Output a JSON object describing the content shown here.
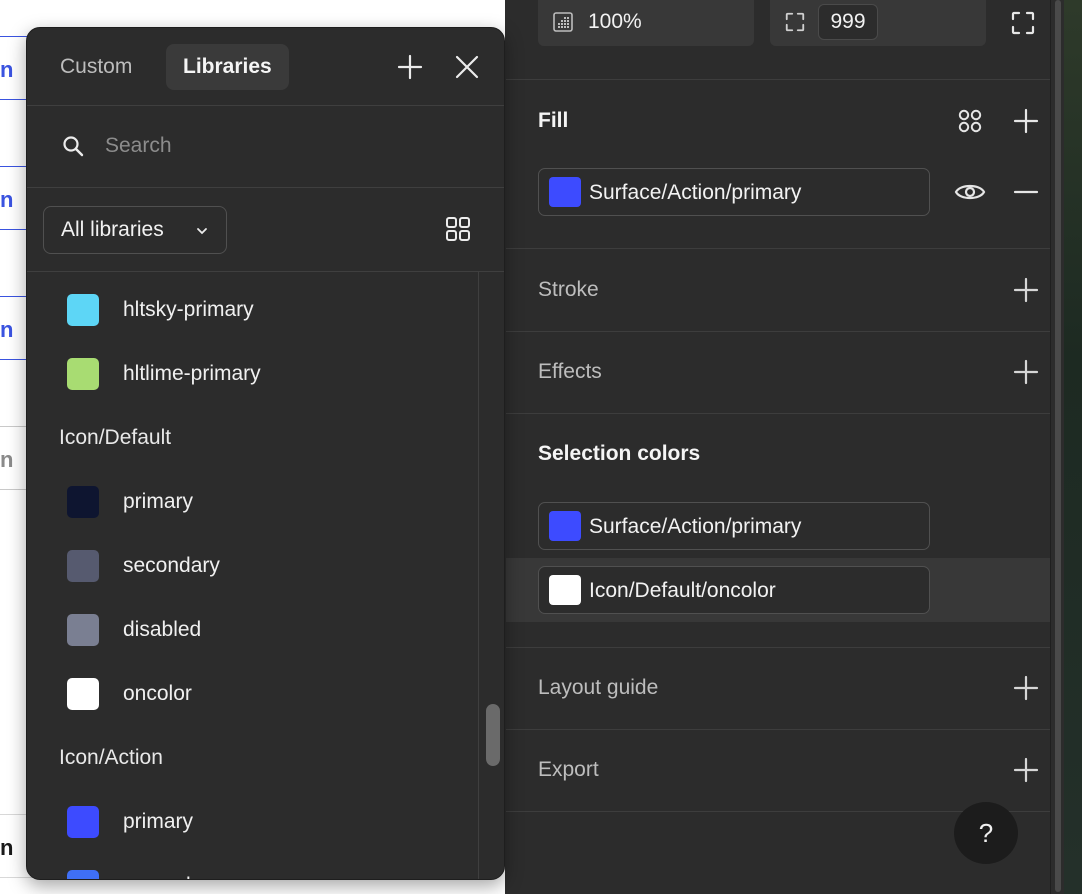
{
  "canvas": {
    "items": [
      {
        "glyph": "n",
        "tone": "blue"
      },
      {
        "glyph": "n",
        "tone": "blue"
      },
      {
        "glyph": "n",
        "tone": "blue"
      },
      {
        "glyph": "n",
        "tone": "grey"
      },
      {
        "glyph": "n",
        "tone": "dark"
      }
    ]
  },
  "properties": {
    "opacity": "100%",
    "corner_radius": "999",
    "fill": {
      "title": "Fill",
      "color": {
        "name": "Surface/Action/primary",
        "hex": "#3d4bff"
      }
    },
    "stroke": {
      "title": "Stroke"
    },
    "effects": {
      "title": "Effects"
    },
    "selection_colors": {
      "title": "Selection colors",
      "items": [
        {
          "name": "Surface/Action/primary",
          "hex": "#3d4bff"
        },
        {
          "name": "Icon/Default/oncolor",
          "hex": "#ffffff"
        }
      ]
    },
    "layout_guide": {
      "title": "Layout guide"
    },
    "export": {
      "title": "Export"
    },
    "help_label": "?"
  },
  "libraries_popover": {
    "tabs": [
      {
        "label": "Custom",
        "active": false
      },
      {
        "label": "Libraries",
        "active": true
      }
    ],
    "search": {
      "placeholder": "Search",
      "value": ""
    },
    "library_filter": "All libraries",
    "list": {
      "ungrouped": [
        {
          "name": "hltsky-primary",
          "hex": "#5dd6f6"
        },
        {
          "name": "hltlime-primary",
          "hex": "#a8dc72"
        }
      ],
      "groups": [
        {
          "title": "Icon/Default",
          "items": [
            {
              "name": "primary",
              "hex": "#0e1530"
            },
            {
              "name": "secondary",
              "hex": "#565a6f"
            },
            {
              "name": "disabled",
              "hex": "#7a7f92"
            },
            {
              "name": "oncolor",
              "hex": "#ffffff"
            }
          ]
        },
        {
          "title": "Icon/Action",
          "items": [
            {
              "name": "primary",
              "hex": "#3d4bff"
            },
            {
              "name": "secondary",
              "hex": "#3f6ff5"
            }
          ]
        }
      ]
    }
  },
  "colors": {
    "panel_bg": "#2c2c2c",
    "divider": "#3d3d3d",
    "accent_blue": "#3a53e0"
  }
}
